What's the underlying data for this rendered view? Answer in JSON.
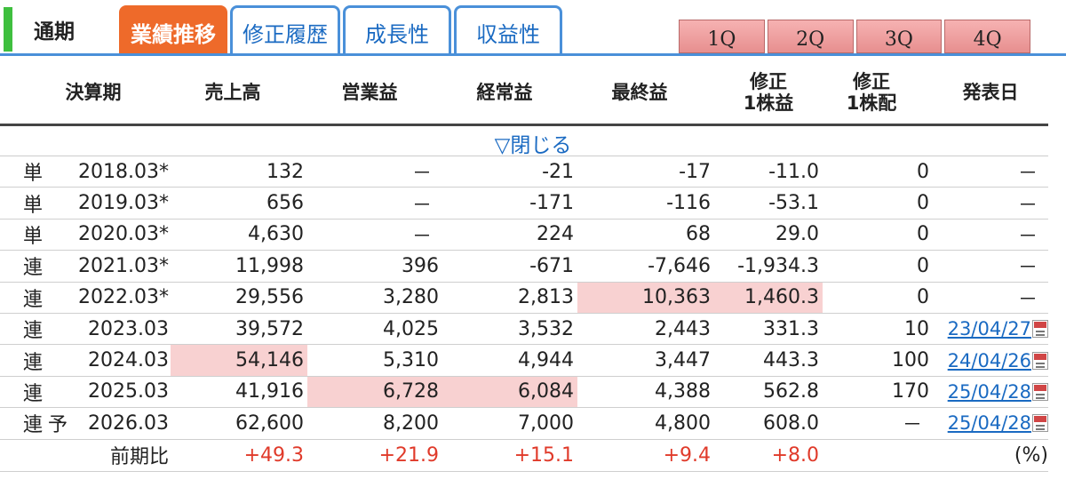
{
  "tabs": {
    "period_label": "通期",
    "items": [
      {
        "label": "業績推移",
        "active": true
      },
      {
        "label": "修正履歴",
        "active": false
      },
      {
        "label": "成長性",
        "active": false
      },
      {
        "label": "収益性",
        "active": false
      }
    ]
  },
  "quarters": [
    "1Q",
    "2Q",
    "3Q",
    "4Q"
  ],
  "columns": {
    "period": "決算期",
    "sales": "売上高",
    "operating": "営業益",
    "ordinary": "経常益",
    "net": "最終益",
    "eps_line1": "修正",
    "eps_line2": "1株益",
    "div_line1": "修正",
    "div_line2": "1株配",
    "date": "発表日"
  },
  "toggle_label": "▽閉じる",
  "rows": [
    {
      "type": "単",
      "forecast": "",
      "period": "2018.03*",
      "sales": "132",
      "operating": "－",
      "ordinary": "-21",
      "net": "-17",
      "eps": "-11.0",
      "div": "0",
      "date": "－"
    },
    {
      "type": "単",
      "forecast": "",
      "period": "2019.03*",
      "sales": "656",
      "operating": "－",
      "ordinary": "-171",
      "net": "-116",
      "eps": "-53.1",
      "div": "0",
      "date": "－"
    },
    {
      "type": "単",
      "forecast": "",
      "period": "2020.03*",
      "sales": "4,630",
      "operating": "－",
      "ordinary": "224",
      "net": "68",
      "eps": "29.0",
      "div": "0",
      "date": "－"
    },
    {
      "type": "連",
      "forecast": "",
      "period": "2021.03*",
      "sales": "11,998",
      "operating": "396",
      "ordinary": "-671",
      "net": "-7,646",
      "eps": "-1,934.3",
      "div": "0",
      "date": "－"
    },
    {
      "type": "連",
      "forecast": "",
      "period": "2022.03*",
      "sales": "29,556",
      "operating": "3,280",
      "ordinary": "2,813",
      "net": "10,363",
      "eps": "1,460.3",
      "div": "0",
      "date": "－"
    },
    {
      "type": "連",
      "forecast": "",
      "period": "2023.03",
      "sales": "39,572",
      "operating": "4,025",
      "ordinary": "3,532",
      "net": "2,443",
      "eps": "331.3",
      "div": "10",
      "date": "23/04/27"
    },
    {
      "type": "連",
      "forecast": "",
      "period": "2024.03",
      "sales": "54,146",
      "operating": "5,310",
      "ordinary": "4,944",
      "net": "3,447",
      "eps": "443.3",
      "div": "100",
      "date": "24/04/26"
    },
    {
      "type": "連",
      "forecast": "",
      "period": "2025.03",
      "sales": "41,916",
      "operating": "6,728",
      "ordinary": "6,084",
      "net": "4,388",
      "eps": "562.8",
      "div": "170",
      "date": "25/04/28"
    },
    {
      "type": "連",
      "forecast": "予",
      "period": "2026.03",
      "sales": "62,600",
      "operating": "8,200",
      "ordinary": "7,000",
      "net": "4,800",
      "eps": "608.0",
      "div": "－",
      "date": "25/04/28"
    }
  ],
  "ratio": {
    "label": "前期比",
    "sales": "+49.3",
    "operating": "+21.9",
    "ordinary": "+15.1",
    "net": "+9.4",
    "eps": "+8.0",
    "unit": "(%)"
  },
  "colors": {
    "active_tab": "#ee6a2a",
    "tab_border": "#4a90d9",
    "highlight": "#f8d1d1",
    "positive_change": "#e03a2a",
    "link": "#1a6ac2"
  }
}
